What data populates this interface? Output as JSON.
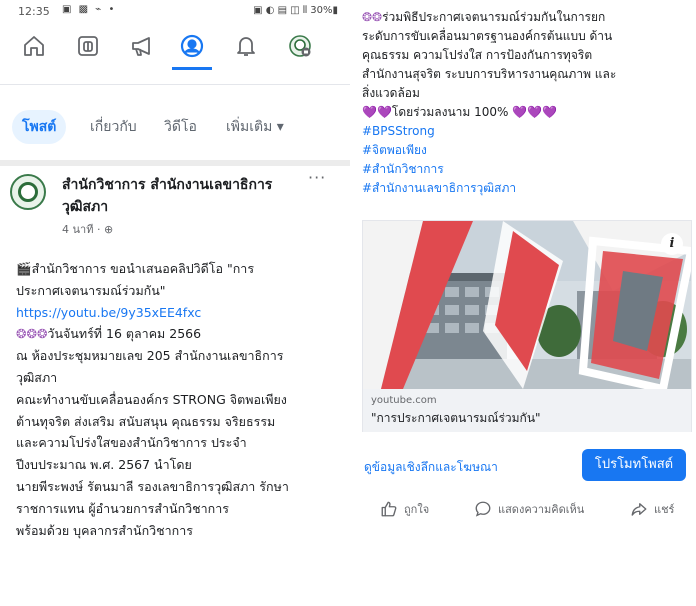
{
  "status_bar": {
    "time": "12:35",
    "left_icons": "▣ ▩ ⌁ •",
    "right_icons": "▣ ◐ ▤ ◫ ⫴ 30%▮"
  },
  "nav": {
    "icons": [
      "home-icon",
      "news-icon",
      "megaphone-icon",
      "profile-icon",
      "bell-icon",
      "page-avatar-icon"
    ],
    "active_index": 3,
    "accent_color": "#1877f2"
  },
  "tabs": {
    "posts": "โพสต์",
    "about": "เกี่ยวกับ",
    "videos": "วิดีโอ",
    "more": "เพิ่มเติม ▾"
  },
  "post": {
    "author_line1": "สำนักวิชาการ สำนักงานเลขาธิการ",
    "author_line2": "วุฒิสภา",
    "time": "4 นาที",
    "more_label": "···",
    "lines": [
      "สำนักวิชาการ ขอนำเสนอคลิปวิดีโอ \"การ",
      "ประกาศเจตนารมณ์ร่วมกัน\"",
      "https://youtu.be/9y35xEE4fxc",
      "วันจันทร์ที่ 16 ตุลาคม 2566",
      "ณ ห้องประชุมหมายเลข 205 สำนักงานเลขาธิการ",
      "วุฒิสภา",
      "คณะทำงานขับเคลื่อนองค์กร STRONG จิตพอเพียง",
      "ต้านทุจริต ส่งเสริม สนับสนุน คุณธรรม จริยธรรม",
      "และความโปร่งใสของสำนักวิชาการ ประจำ",
      "ปีงบประมาณ พ.ศ. 2567 นำโดย",
      "นายพีระพงษ์ รัตนมาลี รองเลขาธิการวุฒิสภา รักษา",
      "ราชการแทน ผู้อำนวยการสำนักวิชาการ",
      "พร้อมด้วย บุคลากรสำนักวิชาการ"
    ]
  },
  "right": {
    "lines": [
      "ร่วมพิธีประกาศเจตนารมณ์ร่วมกันในการยก",
      "ระดับการขับเคลื่อนมาตรฐานองค์กรต้นแบบ ด้าน",
      "คุณธรรม ความโปร่งใส การป้องกันการทุจริต",
      "สำนักงานสุจริต ระบบการบริหารงานคุณภาพ และ",
      "สิ่งแวดล้อม"
    ],
    "sign_line": "โดยร่วมลงนาม 100%",
    "hashtags": [
      "#BPSStrong",
      "#จิตพอเพียง",
      "#สำนักวิชาการ",
      "#สำนักงานเลขาธิการวุฒิสภา"
    ],
    "link_card": {
      "domain": "youtube.com",
      "title": "\"การประกาศเจตนารมณ์ร่วมกัน\"",
      "info_label": "i"
    },
    "insights_link": "ดูข้อมูลเชิงลึกและโฆษณา",
    "promote_button": "โปรโมทโพสต์",
    "actions": {
      "like": "ถูกใจ",
      "comment": "แสดงความคิดเห็น",
      "share": "แชร์"
    }
  }
}
